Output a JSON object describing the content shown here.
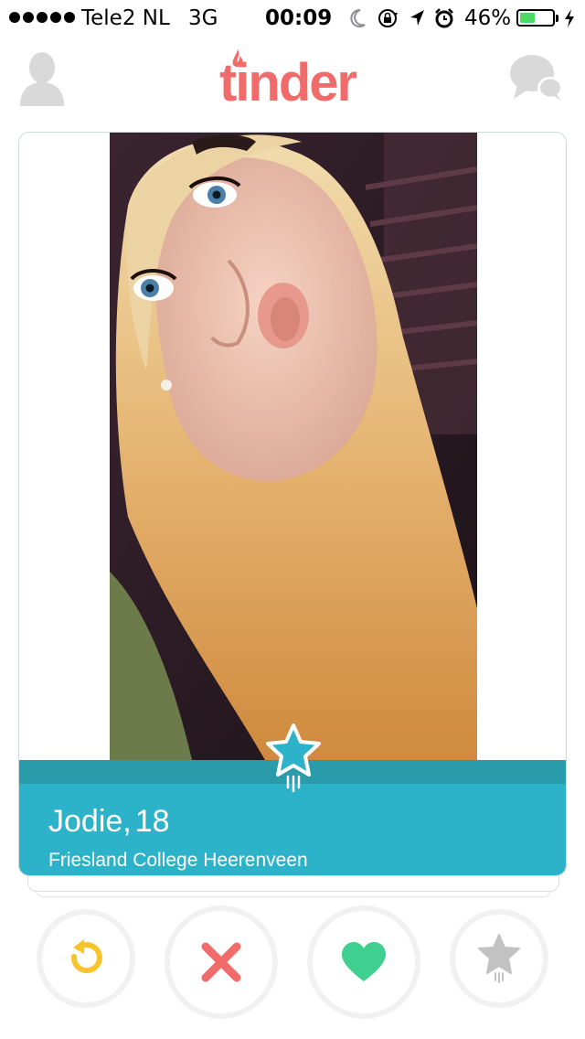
{
  "status_bar": {
    "carrier": "Tele2 NL",
    "network": "3G",
    "time": "00:09",
    "battery_percent_text": "46%",
    "battery_level": 0.46,
    "icons": [
      "signal-dots-icon",
      "moon-icon",
      "rotation-lock-icon",
      "location-arrow-icon",
      "alarm-icon",
      "battery-icon",
      "charging-bolt-icon"
    ]
  },
  "header": {
    "logo_text": "tinder",
    "logo_color": "#f06b6a",
    "icons": [
      "profile-icon",
      "messages-icon"
    ],
    "icon_color": "#d9d9d9"
  },
  "card": {
    "name": "Jodie,",
    "age": "18",
    "school": "Friesland College Heerenveen",
    "panel_color": "#2db3c9",
    "badge_icon": "superlike-star-icon"
  },
  "actions": {
    "rewind": {
      "icon": "rewind-icon",
      "color": "#f7c52b"
    },
    "dislike": {
      "icon": "close-x-icon",
      "color": "#f06b6a"
    },
    "like": {
      "icon": "heart-icon",
      "color": "#3fcf8e"
    },
    "superlike": {
      "icon": "star-icon",
      "color": "#c2c2c2"
    }
  }
}
